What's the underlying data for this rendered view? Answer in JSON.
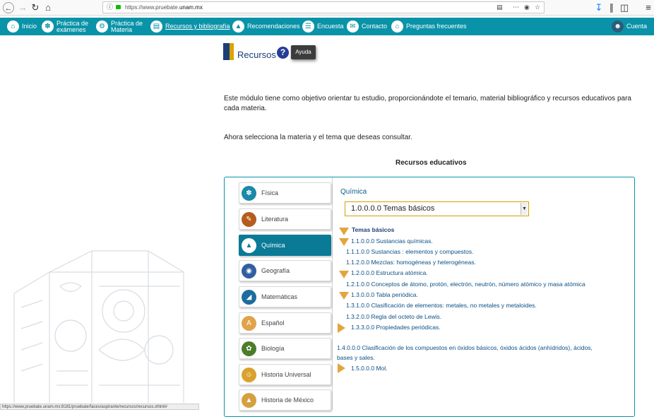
{
  "browser": {
    "url_prefix": "https://www.pruebate.",
    "url_domain": "unam.mx",
    "status_url": "https://www.pruebate.unam.mx:8181/pruebate/faces/aspirante/recursos/recursos.xhtml#"
  },
  "nav": {
    "items": [
      {
        "label": "Inicio"
      },
      {
        "label": "Práctica de exámenes",
        "line1": "Práctica de",
        "line2": "exámenes"
      },
      {
        "label": "Práctica de Materia",
        "line1": "Práctica de",
        "line2": "Materia"
      },
      {
        "label": "Recursos y bibliografía"
      },
      {
        "label": "Recomendaciones"
      },
      {
        "label": "Encuesta"
      },
      {
        "label": "Contacto"
      },
      {
        "label": "Preguntas frecuentes"
      }
    ],
    "account": "Cuenta"
  },
  "page": {
    "title": "Recursos",
    "tooltip": "Ayuda",
    "intro": "Este módulo tiene como objetivo orientar tu estudio, proporcionándote el temario, material bibliográfico y recursos educativos para cada materia.",
    "select_msg": "Ahora selecciona la materia y el tema que deseas consultar.",
    "section_title": "Recursos educativos"
  },
  "subjects": [
    {
      "label": "Física"
    },
    {
      "label": "Literatura"
    },
    {
      "label": "Química"
    },
    {
      "label": "Geografía"
    },
    {
      "label": "Matemáticas"
    },
    {
      "label": "Español"
    },
    {
      "label": "Biología"
    },
    {
      "label": "Historia Universal"
    },
    {
      "label": "Historia de México"
    }
  ],
  "detail": {
    "subject": "Química",
    "selected_topic": "1.0.0.0.0 Temas básicos",
    "tree": [
      {
        "text": "Temas básicos",
        "marker": "down"
      },
      {
        "text": "1.1.0.0.0 Sustancias químicas.",
        "marker": "down"
      },
      {
        "text": "1.1.1.0.0 Sustancias : elementos y compuestos.",
        "marker": "none"
      },
      {
        "text": "1.1.2.0.0 Mezclas: homogéneas y heterogéneas.",
        "marker": "none"
      },
      {
        "text": "1.2.0.0.0 Estructura atómica.",
        "marker": "down"
      },
      {
        "text": "1.2.1.0.0 Conceptos de átomo, protón, electrón, neutrón, número atómico y masa atómica",
        "marker": "none"
      },
      {
        "text": "1.3.0.0.0 Tabla periódica.",
        "marker": "down"
      },
      {
        "text": "1.3.1.0.0 Clasificación de elementos: metales, no metales y metaloides.",
        "marker": "none"
      },
      {
        "text": "1.3.2.0.0 Regla del octeto de Lewis.",
        "marker": "none"
      },
      {
        "text": "1.3.3.0.0 Propiedades periódicas.",
        "marker": "right"
      },
      {
        "text": "1.4.0.0.0 Clasificación de los compuestos en óxidos básicos, óxidos ácidos (anhídridos), ácidos,",
        "marker": "none"
      },
      {
        "text": "bases y sales.",
        "marker": "none"
      },
      {
        "text": "1.5.0.0.0 Mol.",
        "marker": "right"
      }
    ]
  },
  "colors": {
    "nav_bg": "#0a93a8",
    "active_subject": "#0a7a96",
    "marker": "#e2a53d",
    "link_text": "#0b4f86"
  }
}
